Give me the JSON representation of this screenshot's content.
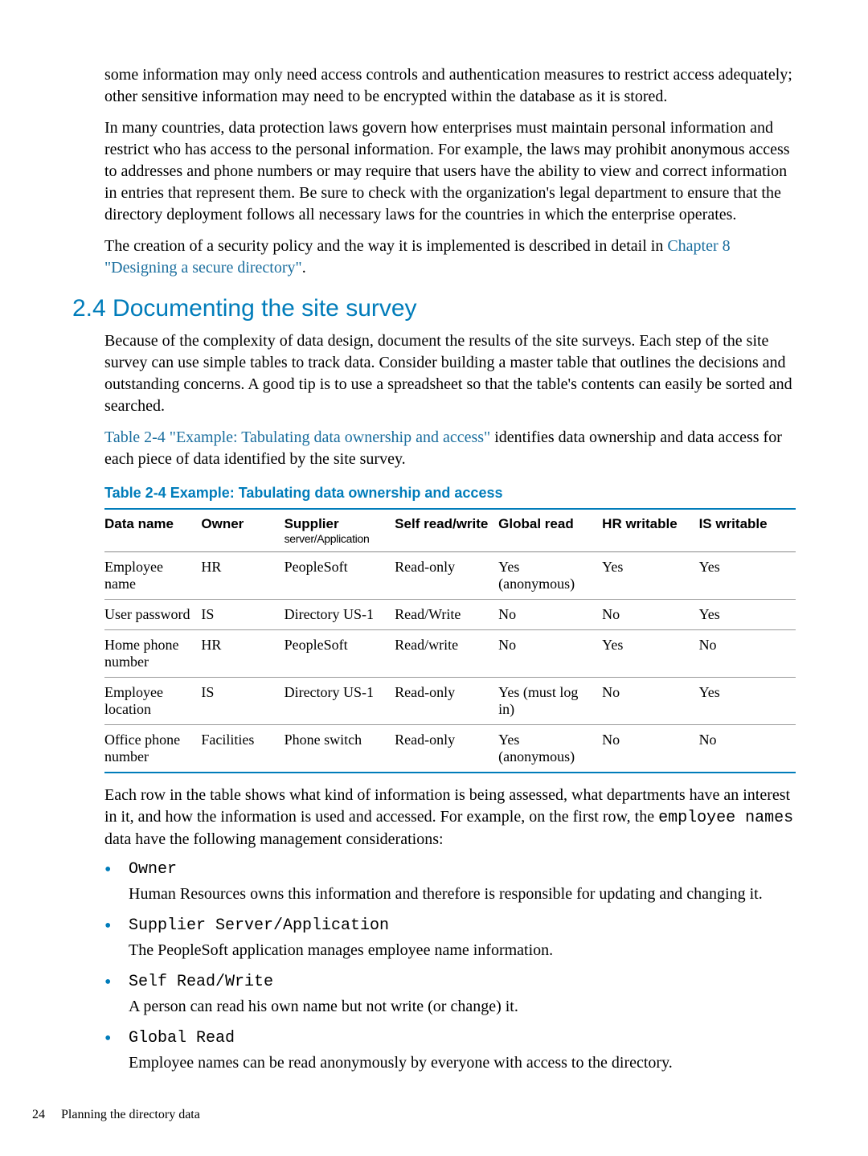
{
  "intro": {
    "p1": "some information may only need access controls and authentication measures to restrict access adequately; other sensitive information may need to be encrypted within the database as it is stored.",
    "p2": "In many countries, data protection laws govern how enterprises must maintain personal information and restrict who has access to the personal information. For example, the laws may prohibit anonymous access to addresses and phone numbers or may require that users have the ability to view and correct information in entries that represent them. Be sure to check with the organization's legal department to ensure that the directory deployment follows all necessary laws for the countries in which the enterprise operates.",
    "p3_a": "The creation of a security policy and the way it is implemented is described in detail in ",
    "p3_link": "Chapter 8 \"Designing a secure directory\"",
    "p3_b": "."
  },
  "section": {
    "heading": "2.4 Documenting the site survey",
    "p1": "Because of the complexity of data design, document the results of the site surveys. Each step of the site survey can use simple tables to track data. Consider building a master table that outlines the decisions and outstanding concerns. A good tip is to use a spreadsheet so that the table's contents can easily be sorted and searched.",
    "p2_link": "Table 2-4 \"Example: Tabulating data ownership and access\"",
    "p2_b": " identifies data ownership and data access for each piece of data identified by the site survey."
  },
  "table": {
    "title": "Table 2-4 Example: Tabulating data ownership and access",
    "headers": {
      "c0": "Data name",
      "c1": "Owner",
      "c2": "Supplier",
      "c2sub": "server/Application",
      "c3": "Self read/write",
      "c4": "Global read",
      "c5": "HR writable",
      "c6": "IS writable"
    },
    "rows": [
      {
        "c0": "Employee name",
        "c1": "HR",
        "c2": "PeopleSoft",
        "c3": "Read-only",
        "c4": "Yes (anonymous)",
        "c5": "Yes",
        "c6": "Yes"
      },
      {
        "c0": "User password",
        "c1": "IS",
        "c2": "Directory US-1",
        "c3": "Read/Write",
        "c4": "No",
        "c5": "No",
        "c6": "Yes"
      },
      {
        "c0": "Home phone number",
        "c1": "HR",
        "c2": "PeopleSoft",
        "c3": "Read/write",
        "c4": "No",
        "c5": "Yes",
        "c6": "No"
      },
      {
        "c0": "Employee location",
        "c1": "IS",
        "c2": "Directory US-1",
        "c3": "Read-only",
        "c4": "Yes (must log in)",
        "c5": "No",
        "c6": "Yes"
      },
      {
        "c0": "Office phone number",
        "c1": "Facilities",
        "c2": "Phone switch",
        "c3": "Read-only",
        "c4": "Yes (anonymous)",
        "c5": "No",
        "c6": "No"
      }
    ]
  },
  "after_table": {
    "p1_a": "Each row in the table shows what kind of information is being assessed, what departments have an interest in it, and how the information is used and accessed. For example, on the first row, the ",
    "p1_code": "employee names",
    "p1_b": " data have the following management considerations:"
  },
  "bullets": [
    {
      "term": "Owner",
      "desc": "Human Resources owns this information and therefore is responsible for updating and changing it."
    },
    {
      "term": "Supplier Server/Application",
      "desc": "The PeopleSoft application manages employee name information."
    },
    {
      "term": "Self Read/Write",
      "desc": "A person can read his own name but not write (or change) it."
    },
    {
      "term": "Global Read",
      "desc": "Employee names can be read anonymously by everyone with access to the directory."
    }
  ],
  "footer": {
    "page": "24",
    "title": "Planning the directory data"
  }
}
